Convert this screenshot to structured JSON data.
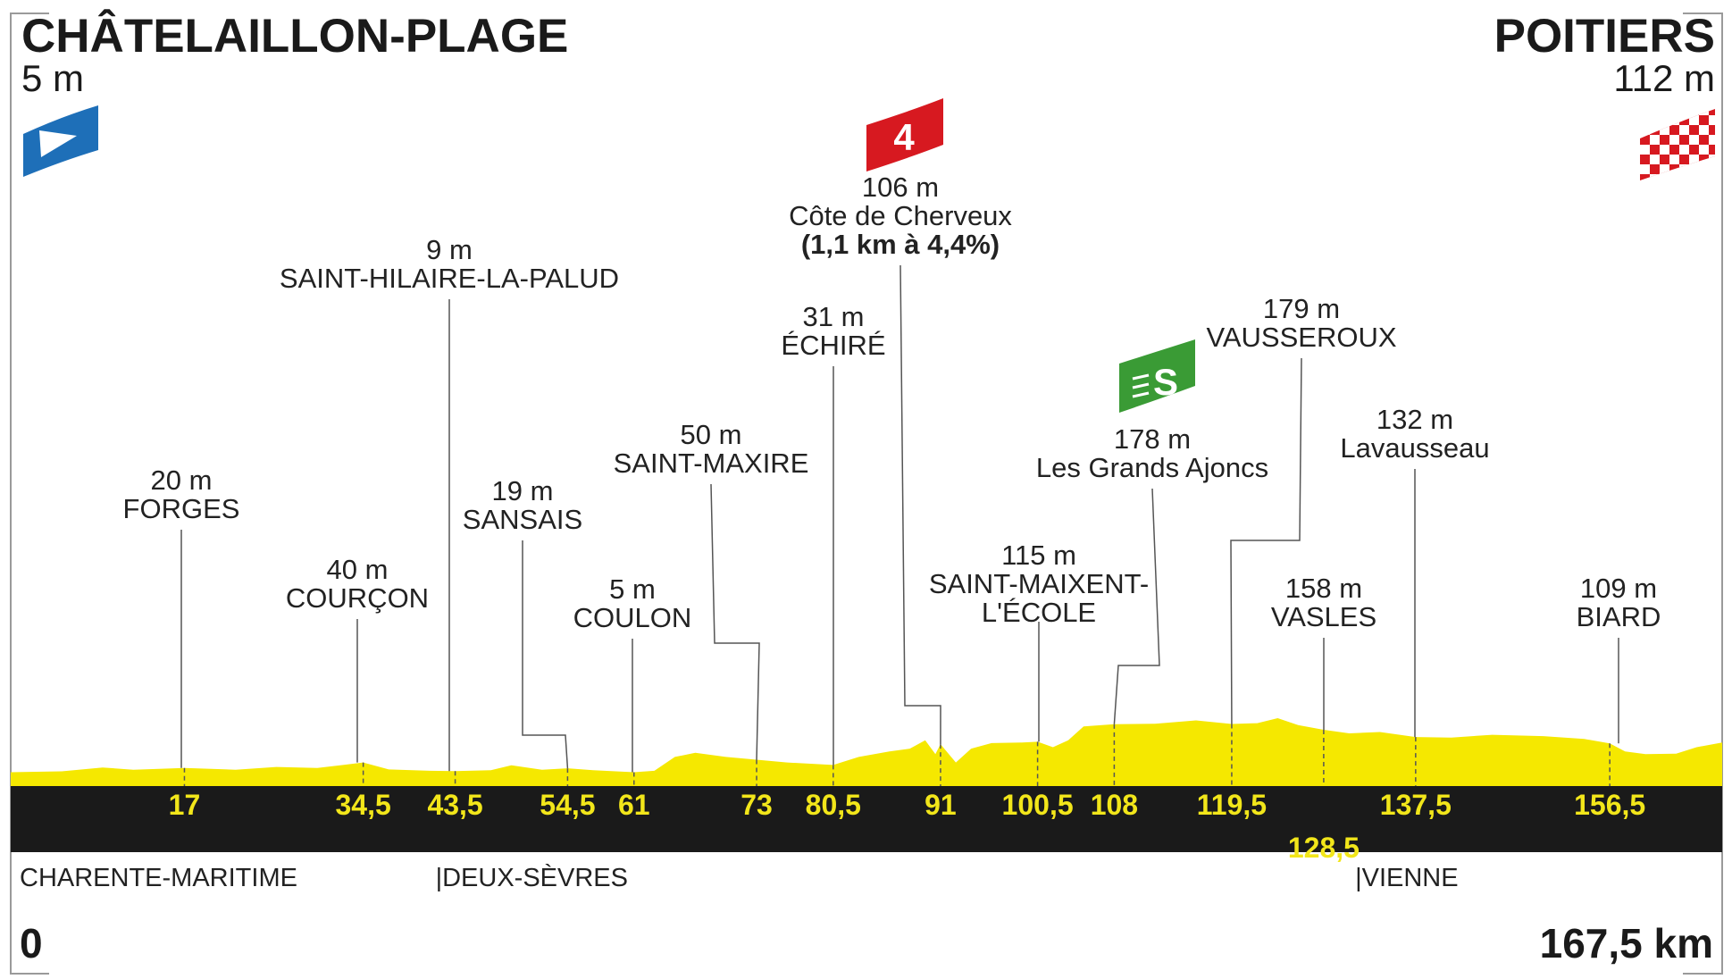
{
  "start": {
    "name": "CHÂTELAILLON-PLAGE",
    "altitude": "5 m"
  },
  "finish": {
    "name": "POITIERS",
    "altitude": "112 m"
  },
  "distance_start": "0",
  "distance_end": "167,5 km",
  "climb_category": "4",
  "sprint_symbol": "S",
  "colors": {
    "profile": "#f5e800",
    "band": "#1a1a1a",
    "km_text": "#f2e61a",
    "climb": "#d71920",
    "sprint": "#3a9b35",
    "start_flag": "#1e6fb8"
  },
  "regions": [
    {
      "name": "CHARENTE-MARITIME",
      "km": 0
    },
    {
      "name": "|DEUX-SÈVRES",
      "km": 43.5
    },
    {
      "name": "|VIENNE",
      "km": 133.5
    }
  ],
  "chart_data": {
    "type": "area",
    "title": "",
    "xlabel": "",
    "ylabel": "",
    "xlim": [
      0,
      167.5
    ],
    "ylim": [
      0,
      600
    ],
    "waypoints": [
      {
        "km": 17,
        "km_label": "17",
        "altitude_m": 20,
        "altitude_label": "20 m",
        "name": "FORGES"
      },
      {
        "km": 34.5,
        "km_label": "34,5",
        "altitude_m": 40,
        "altitude_label": "40 m",
        "name": "COURÇON"
      },
      {
        "km": 43.5,
        "km_label": "43,5",
        "altitude_m": 9,
        "altitude_label": "9 m",
        "name": "SAINT-HILAIRE-LA-PALUD"
      },
      {
        "km": 54.5,
        "km_label": "54,5",
        "altitude_m": 19,
        "altitude_label": "19 m",
        "name": "SANSAIS"
      },
      {
        "km": 61,
        "km_label": "61",
        "altitude_m": 5,
        "altitude_label": "5 m",
        "name": "COULON"
      },
      {
        "km": 73,
        "km_label": "73",
        "altitude_m": 50,
        "altitude_label": "50 m",
        "name": "SAINT-MAXIRE"
      },
      {
        "km": 80.5,
        "km_label": "80,5",
        "altitude_m": 31,
        "altitude_label": "31 m",
        "name": "ÉCHIRÉ"
      },
      {
        "km": 91,
        "km_label": "91",
        "altitude_m": 106,
        "altitude_label": "106 m",
        "name": "Côte de Cherveux",
        "extra": "(1,1 km à 4,4%)",
        "climb": true
      },
      {
        "km": 100.5,
        "km_label": "100,5",
        "altitude_m": 115,
        "altitude_label": "115 m",
        "name": "SAINT-MAIXENT-",
        "name2": "L'ÉCOLE"
      },
      {
        "km": 108,
        "km_label": "108",
        "altitude_m": 178,
        "altitude_label": "178 m",
        "name": "Les Grands Ajoncs",
        "sprint": true
      },
      {
        "km": 119.5,
        "km_label": "119,5",
        "altitude_m": 179,
        "altitude_label": "179 m",
        "name": "VAUSSEROUX"
      },
      {
        "km": 128.5,
        "km_label": "128,5",
        "altitude_m": 158,
        "altitude_label": "158 m",
        "name": "VASLES"
      },
      {
        "km": 137.5,
        "km_label": "137,5",
        "altitude_m": 132,
        "altitude_label": "132 m",
        "name": "Lavausseau"
      },
      {
        "km": 156.5,
        "km_label": "156,5",
        "altitude_m": 109,
        "altitude_label": "109 m",
        "name": "BIARD"
      }
    ],
    "profile": [
      [
        0,
        5
      ],
      [
        5,
        8
      ],
      [
        9,
        22
      ],
      [
        12,
        14
      ],
      [
        17,
        20
      ],
      [
        22,
        14
      ],
      [
        26,
        24
      ],
      [
        30,
        20
      ],
      [
        34.5,
        40
      ],
      [
        37,
        15
      ],
      [
        41,
        10
      ],
      [
        43.5,
        9
      ],
      [
        47,
        12
      ],
      [
        49,
        30
      ],
      [
        52,
        14
      ],
      [
        54.5,
        19
      ],
      [
        57,
        12
      ],
      [
        61,
        5
      ],
      [
        63,
        10
      ],
      [
        65,
        60
      ],
      [
        67,
        75
      ],
      [
        70,
        60
      ],
      [
        73,
        50
      ],
      [
        76,
        40
      ],
      [
        80.5,
        31
      ],
      [
        83,
        60
      ],
      [
        86,
        80
      ],
      [
        88,
        90
      ],
      [
        89.5,
        120
      ],
      [
        90.5,
        70
      ],
      [
        91,
        106
      ],
      [
        92.5,
        40
      ],
      [
        94,
        90
      ],
      [
        96,
        110
      ],
      [
        99,
        112
      ],
      [
        100.5,
        115
      ],
      [
        102,
        95
      ],
      [
        103.5,
        120
      ],
      [
        105,
        170
      ],
      [
        108,
        178
      ],
      [
        112,
        180
      ],
      [
        116,
        192
      ],
      [
        119.5,
        179
      ],
      [
        122,
        182
      ],
      [
        124,
        200
      ],
      [
        126,
        175
      ],
      [
        128.5,
        158
      ],
      [
        131,
        145
      ],
      [
        134,
        150
      ],
      [
        137.5,
        132
      ],
      [
        141,
        130
      ],
      [
        145,
        140
      ],
      [
        150,
        135
      ],
      [
        154,
        125
      ],
      [
        156.5,
        109
      ],
      [
        158,
        80
      ],
      [
        160,
        70
      ],
      [
        163,
        72
      ],
      [
        165,
        95
      ],
      [
        167.5,
        112
      ]
    ]
  }
}
